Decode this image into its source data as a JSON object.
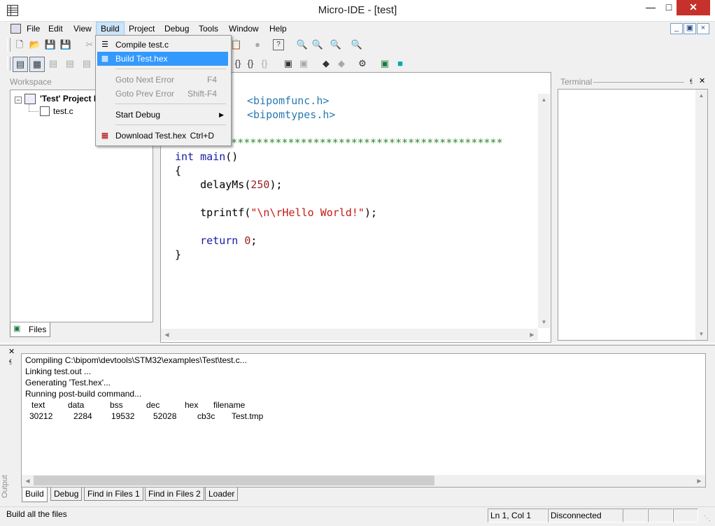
{
  "window": {
    "title": "Micro-IDE - [test]"
  },
  "menu": {
    "items": [
      "File",
      "Edit",
      "View",
      "Build",
      "Project",
      "Debug",
      "Tools",
      "Window",
      "Help"
    ],
    "active": "Build"
  },
  "build_menu": {
    "items": [
      {
        "label": "Compile test.c",
        "shortcut": "",
        "enabled": true,
        "icon": "compile-icon"
      },
      {
        "label": "Build Test.hex",
        "shortcut": "",
        "enabled": true,
        "highlighted": true,
        "icon": "build-icon"
      },
      {
        "label": "Goto Next Error",
        "shortcut": "F4",
        "enabled": false
      },
      {
        "label": "Goto Prev Error",
        "shortcut": "Shift-F4",
        "enabled": false
      },
      {
        "label": "Start Debug",
        "shortcut": "",
        "enabled": true,
        "submenu": true
      },
      {
        "label": "Download Test.hex",
        "shortcut": "Ctrl+D",
        "enabled": true,
        "icon": "download-icon"
      }
    ]
  },
  "workspace": {
    "title": "Workspace",
    "project": "'Test' Project F",
    "file": "test.c",
    "tab": "Files"
  },
  "terminal": {
    "title": "Terminal"
  },
  "editor": {
    "lines": [
      {
        "parts": [
          [
            "inc",
            "<bipomfunc.h>"
          ]
        ]
      },
      {
        "parts": [
          [
            "inc",
            "<bipomtypes.h>"
          ]
        ]
      },
      {
        "parts": [
          [
            "",
            ""
          ]
        ]
      },
      {
        "parts": [
          [
            "cmt",
            "****************************************************"
          ]
        ]
      },
      {
        "parts": [
          [
            "kw",
            "int"
          ],
          [
            "",
            " "
          ],
          [
            "kw",
            "main"
          ],
          [
            "",
            "()"
          ]
        ]
      },
      {
        "parts": [
          [
            "",
            "{"
          ]
        ]
      },
      {
        "parts": [
          [
            "",
            "    delayMs("
          ],
          [
            "num",
            "250"
          ],
          [
            "",
            ");"
          ]
        ]
      },
      {
        "parts": [
          [
            "",
            ""
          ]
        ]
      },
      {
        "parts": [
          [
            "",
            "    tprintf("
          ],
          [
            "str",
            "\"\\n\\rHello World!\""
          ],
          [
            "",
            ");"
          ]
        ]
      },
      {
        "parts": [
          [
            "",
            ""
          ]
        ]
      },
      {
        "parts": [
          [
            "",
            "    "
          ],
          [
            "kw",
            "return"
          ],
          [
            "",
            " "
          ],
          [
            "num",
            "0"
          ],
          [
            "",
            ";"
          ]
        ]
      },
      {
        "parts": [
          [
            "",
            "}"
          ]
        ]
      }
    ]
  },
  "output": {
    "label": "Output",
    "lines": [
      "Compiling C:\\bipom\\devtools\\STM32\\examples\\Test\\test.c...",
      "Linking test.out ...",
      "Generating 'Test.hex'...",
      "Running post-build command..."
    ],
    "table_headers": [
      "text",
      "data",
      "bss",
      "dec",
      "hex",
      "filename"
    ],
    "table_values": [
      "30212",
      "2284",
      "19532",
      "52028",
      "cb3c",
      "Test.tmp"
    ],
    "tabs": [
      "Build",
      "Debug",
      "Find in Files 1",
      "Find in Files 2",
      "Loader"
    ],
    "active_tab": "Build"
  },
  "status": {
    "message": "Build all the files",
    "position": "Ln 1, Col 1",
    "connection": "Disconnected"
  }
}
